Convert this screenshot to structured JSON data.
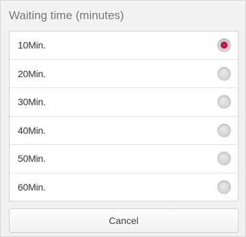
{
  "dialog": {
    "title": "Waiting time (minutes)",
    "options": [
      {
        "label": "10Min.",
        "selected": true
      },
      {
        "label": "20Min.",
        "selected": false
      },
      {
        "label": "30Min.",
        "selected": false
      },
      {
        "label": "40Min.",
        "selected": false
      },
      {
        "label": "50Min.",
        "selected": false
      },
      {
        "label": "60Min.",
        "selected": false
      }
    ],
    "cancel_label": "Cancel"
  },
  "colors": {
    "accent": "#c2185b",
    "background": "#f1f1f1",
    "list_background": "#ffffff"
  }
}
